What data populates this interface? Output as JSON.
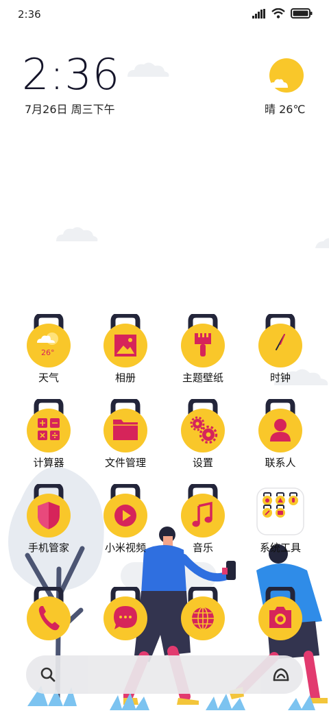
{
  "status_bar": {
    "time": "2:36",
    "icons": [
      "signal-icon",
      "wifi-icon",
      "battery-icon"
    ]
  },
  "clock_widget": {
    "time": "2:36",
    "date": "7月26日 周三下午"
  },
  "weather_widget": {
    "condition_temp": "晴 26℃",
    "icon": "sunny-cloud-icon"
  },
  "theme_colors": {
    "icon_yellow": "#F9C72A",
    "icon_magenta": "#D6245A",
    "kettlebell_handle": "#23253A"
  },
  "apps": [
    {
      "label": "天气",
      "icon": "weather-icon",
      "badge_text": "26°"
    },
    {
      "label": "相册",
      "icon": "gallery-icon"
    },
    {
      "label": "主题壁纸",
      "icon": "theme-brush-icon"
    },
    {
      "label": "时钟",
      "icon": "clock-icon"
    },
    {
      "label": "计算器",
      "icon": "calculator-icon"
    },
    {
      "label": "文件管理",
      "icon": "folder-icon"
    },
    {
      "label": "设置",
      "icon": "settings-gear-icon"
    },
    {
      "label": "联系人",
      "icon": "contacts-icon"
    },
    {
      "label": "手机管家",
      "icon": "security-shield-icon"
    },
    {
      "label": "小米视频",
      "icon": "video-play-icon"
    },
    {
      "label": "音乐",
      "icon": "music-note-icon"
    },
    {
      "label": "系统工具",
      "icon": "folder-system-tools-icon"
    }
  ],
  "dock": [
    {
      "icon": "phone-icon"
    },
    {
      "icon": "messages-icon"
    },
    {
      "icon": "browser-globe-icon"
    },
    {
      "icon": "camera-icon"
    }
  ],
  "search": {
    "icon": "search-icon",
    "assistant_icon": "xiaoai-icon"
  }
}
